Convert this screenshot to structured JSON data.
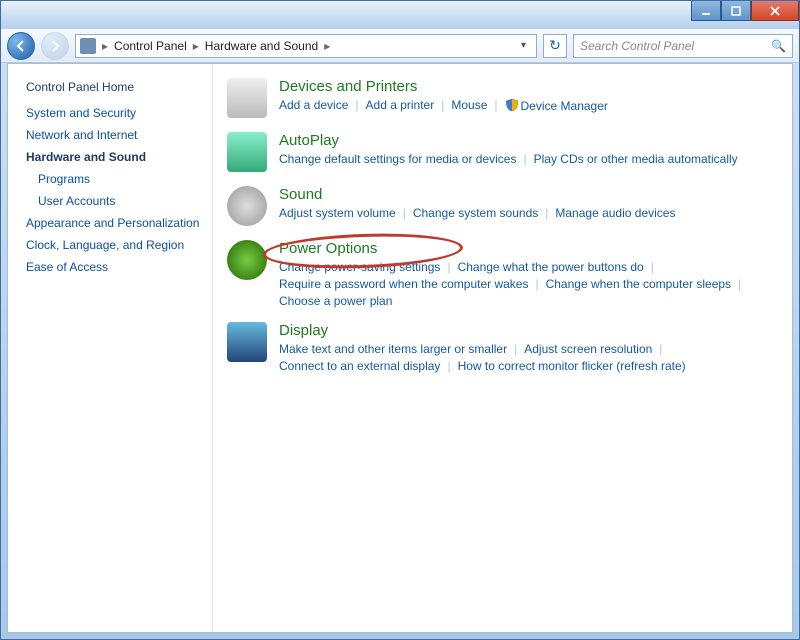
{
  "breadcrumb": {
    "root_icon": "control-panel",
    "items": [
      "Control Panel",
      "Hardware and Sound"
    ]
  },
  "search": {
    "placeholder": "Search Control Panel"
  },
  "sidebar": {
    "home": "Control Panel Home",
    "items": [
      {
        "label": "System and Security",
        "active": false
      },
      {
        "label": "Network and Internet",
        "active": false
      },
      {
        "label": "Hardware and Sound",
        "active": true
      },
      {
        "label": "Programs",
        "active": false,
        "sub": true
      },
      {
        "label": "User Accounts",
        "active": false,
        "sub": true
      },
      {
        "label": "Appearance and Personalization",
        "active": false
      },
      {
        "label": "Clock, Language, and Region",
        "active": false
      },
      {
        "label": "Ease of Access",
        "active": false
      }
    ]
  },
  "categories": [
    {
      "title": "Devices and Printers",
      "icon": "printer",
      "links": [
        "Add a device",
        "Add a printer",
        "Mouse",
        {
          "shield": true,
          "text": "Device Manager"
        }
      ]
    },
    {
      "title": "AutoPlay",
      "icon": "autoplay",
      "links": [
        "Change default settings for media or devices",
        "Play CDs or other media automatically"
      ]
    },
    {
      "title": "Sound",
      "icon": "sound",
      "links": [
        "Adjust system volume",
        "Change system sounds",
        "Manage audio devices"
      ]
    },
    {
      "title": "Power Options",
      "icon": "power",
      "annotated": true,
      "links": [
        "Change power-saving settings",
        "Change what the power buttons do",
        "Require a password when the computer wakes",
        "Change when the computer sleeps",
        "Choose a power plan"
      ]
    },
    {
      "title": "Display",
      "icon": "display",
      "links": [
        "Make text and other items larger or smaller",
        "Adjust screen resolution",
        "Connect to an external display",
        "How to correct monitor flicker (refresh rate)"
      ]
    }
  ]
}
